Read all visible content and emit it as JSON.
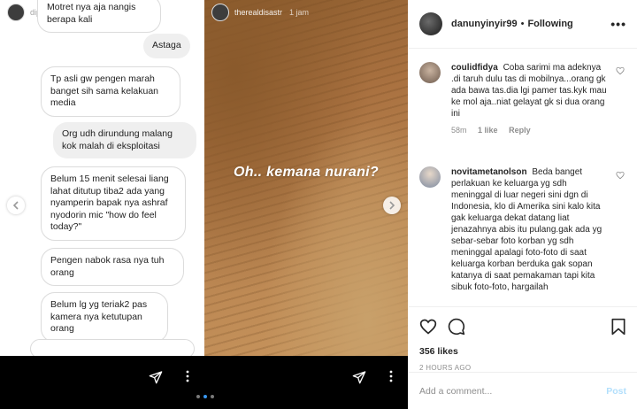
{
  "stories": {
    "left": {
      "username": "dipo_ilham",
      "messages": [
        {
          "text": "Motret nya aja nangis berapa kali",
          "side": "in"
        },
        {
          "text": "Astaga",
          "side": "out"
        },
        {
          "text": "Tp asli gw pengen marah banget sih sama kelakuan media",
          "side": "in"
        },
        {
          "text": "Org udh dirundung malang kok malah di eksploitasi",
          "side": "out"
        },
        {
          "text": "Belum 15 menit selesai liang lahat ditutup tiba2 ada yang nyamperin bapak nya ashraf nyodorin mic \"how do feel today?\"",
          "side": "in"
        },
        {
          "text": "Pengen nabok rasa nya tuh orang",
          "side": "in"
        },
        {
          "text": "Belum lg yg teriak2 pas kamera nya ketutupan orang",
          "side": "in"
        }
      ]
    },
    "right": {
      "username": "therealdisastr",
      "time": "1 jam",
      "text": "Oh.. kemana nurani?"
    }
  },
  "post": {
    "username": "danunyinyir99",
    "separator": "•",
    "follow_status": "Following",
    "more_label": "•••",
    "comments": [
      {
        "user": "coulidfidya",
        "text": "Coba sarimi ma adeknya .di taruh dulu tas di mobilnya...orang gk ada bawa tas.dia lgi pamer tas.kyk mau ke mol aja..niat gelayat gk si dua orang ini",
        "time": "58m",
        "likes": "1 like",
        "reply": "Reply"
      },
      {
        "user": "novitametanolson",
        "text": "Beda banget perlakuan ke keluarga yg sdh meninggal di luar negeri sini dgn di Indonesia, klo di Amerika sini kalo kita gak keluarga dekat datang liat jenazahnya abis itu pulang.gak ada yg sebar-sebar foto korban yg sdh meninggal apalagi foto-foto di saat keluarga korban berduka gak sopan katanya di saat pemakaman tapi kita sibuk foto-foto, hargailah"
      }
    ],
    "likes": "356 likes",
    "time_ago": "2 HOURS AGO",
    "add_comment_placeholder": "Add a comment...",
    "post_label": "Post"
  },
  "colors": {
    "accent": "#3897f0",
    "post_disabled": "#b2dffc",
    "muted": "#8e8e8e"
  }
}
